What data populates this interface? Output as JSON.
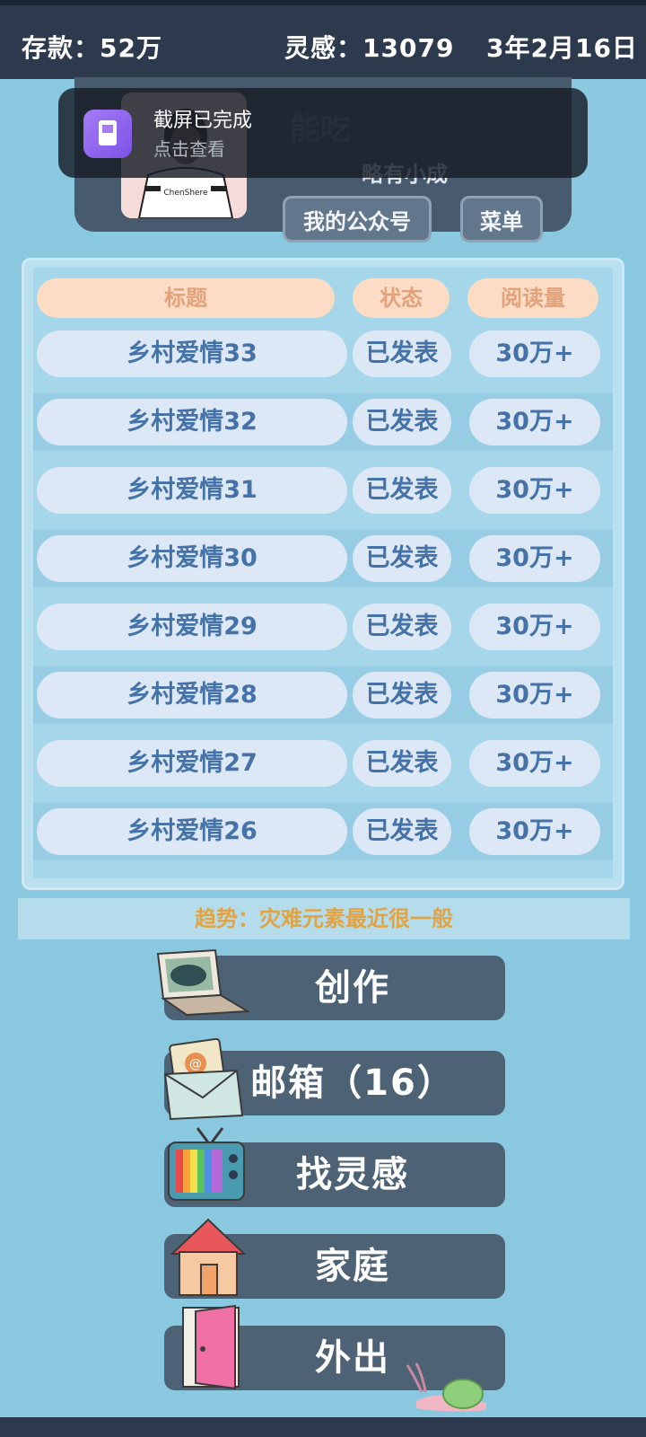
{
  "status": {
    "savings_label": "存款：",
    "savings_value": "52万",
    "inspiration_label": "灵感：",
    "inspiration_value": "13079",
    "date": "3年2月16日"
  },
  "profile": {
    "name": "能吃",
    "level": "略有小成",
    "gzh_button": "我的公众号",
    "menu_button": "菜单"
  },
  "toast": {
    "title": "截屏已完成",
    "subtitle": "点击查看"
  },
  "table": {
    "headers": [
      "标题",
      "状态",
      "阅读量"
    ],
    "rows": [
      {
        "title": "乡村爱情33",
        "status": "已发表",
        "reads": "30万+"
      },
      {
        "title": "乡村爱情32",
        "status": "已发表",
        "reads": "30万+"
      },
      {
        "title": "乡村爱情31",
        "status": "已发表",
        "reads": "30万+"
      },
      {
        "title": "乡村爱情30",
        "status": "已发表",
        "reads": "30万+"
      },
      {
        "title": "乡村爱情29",
        "status": "已发表",
        "reads": "30万+"
      },
      {
        "title": "乡村爱情28",
        "status": "已发表",
        "reads": "30万+"
      },
      {
        "title": "乡村爱情27",
        "status": "已发表",
        "reads": "30万+"
      },
      {
        "title": "乡村爱情26",
        "status": "已发表",
        "reads": "30万+"
      }
    ]
  },
  "trend": "趋势：灾难元素最近很一般",
  "actions": {
    "create": "创作",
    "mailbox": "邮箱（16）",
    "find_inspiration": "找灵感",
    "family": "家庭",
    "go_out": "外出"
  },
  "icons": [
    "laptop-icon",
    "mail-icon",
    "tv-icon",
    "house-icon",
    "door-icon",
    "snail-icon"
  ]
}
